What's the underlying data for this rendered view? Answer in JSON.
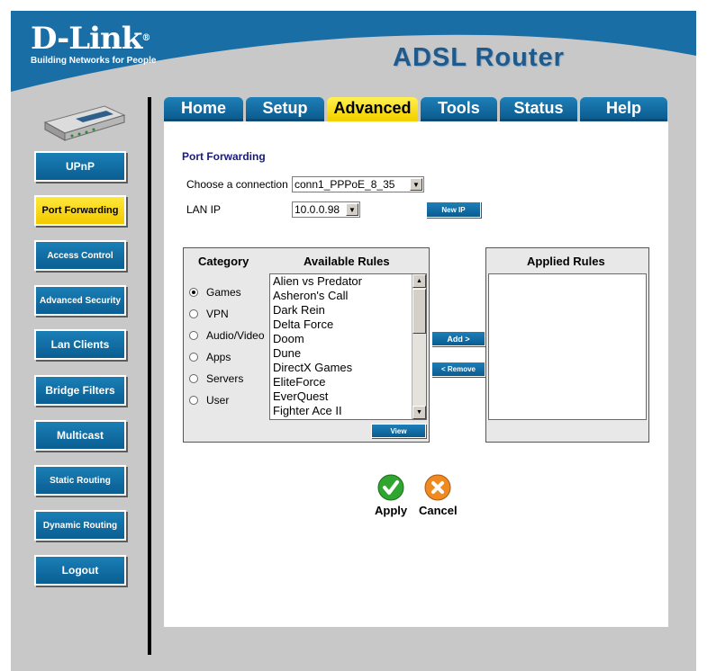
{
  "brand": {
    "name": "D-Link",
    "registered": "®",
    "tagline": "Building Networks for People",
    "product": "ADSL Router"
  },
  "colors": {
    "header_blue": "#1a6ea6",
    "tab_blue": "#0b5d90",
    "active_yellow": "#f4d200",
    "frame_gray": "#c8c8c8"
  },
  "tabs": [
    {
      "label": "Home"
    },
    {
      "label": "Setup"
    },
    {
      "label": "Advanced",
      "active": true
    },
    {
      "label": "Tools"
    },
    {
      "label": "Status"
    },
    {
      "label": "Help"
    }
  ],
  "sidebar": {
    "items": [
      {
        "label": "UPnP"
      },
      {
        "label": "Port Forwarding",
        "active": true
      },
      {
        "label": "Access Control"
      },
      {
        "label": "Advanced Security"
      },
      {
        "label": "Lan Clients"
      },
      {
        "label": "Bridge Filters"
      },
      {
        "label": "Multicast"
      },
      {
        "label": "Static Routing"
      },
      {
        "label": "Dynamic Routing"
      },
      {
        "label": "Logout"
      }
    ]
  },
  "main": {
    "title": "Port Forwarding",
    "connection_label": "Choose a connection",
    "connection_value": "conn1_PPPoE_8_35",
    "lanip_label": "LAN IP",
    "lanip_value": "10.0.0.98",
    "new_ip_button": "New IP",
    "category_header": "Category",
    "available_header": "Available Rules",
    "applied_header": "Applied Rules",
    "categories": [
      {
        "label": "Games",
        "selected": true
      },
      {
        "label": "VPN"
      },
      {
        "label": "Audio/Video"
      },
      {
        "label": "Apps"
      },
      {
        "label": "Servers"
      },
      {
        "label": "User"
      }
    ],
    "available_rules": [
      "Alien vs Predator",
      "Asheron's Call",
      "Dark Rein",
      "Delta Force",
      "Doom",
      "Dune",
      "DirectX Games",
      "EliteForce",
      "EverQuest",
      "Fighter Ace II"
    ],
    "add_button": "Add >",
    "remove_button": "< Remove",
    "view_button": "View",
    "apply_label": "Apply",
    "cancel_label": "Cancel"
  }
}
